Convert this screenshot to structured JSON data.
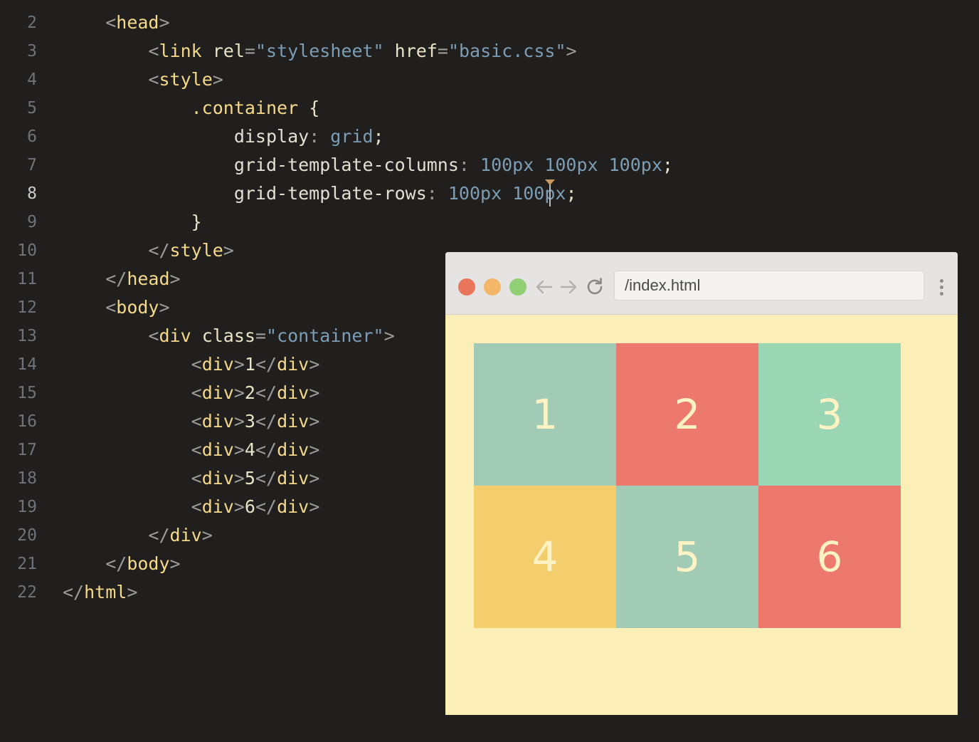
{
  "editor": {
    "lines": [
      {
        "number": "2",
        "tokens": [
          {
            "t": "ind",
            "v": "    "
          },
          {
            "t": "punc",
            "v": "<"
          },
          {
            "t": "tag",
            "v": "head"
          },
          {
            "t": "punc",
            "v": ">"
          }
        ]
      },
      {
        "number": "3",
        "tokens": [
          {
            "t": "ind",
            "v": "        "
          },
          {
            "t": "punc",
            "v": "<"
          },
          {
            "t": "tag",
            "v": "link"
          },
          {
            "t": "attr",
            "v": " rel"
          },
          {
            "t": "punc",
            "v": "="
          },
          {
            "t": "str",
            "v": "\"stylesheet\""
          },
          {
            "t": "attr",
            "v": " href"
          },
          {
            "t": "punc",
            "v": "="
          },
          {
            "t": "str",
            "v": "\"basic.css\""
          },
          {
            "t": "punc",
            "v": ">"
          }
        ]
      },
      {
        "number": "4",
        "tokens": [
          {
            "t": "ind",
            "v": "        "
          },
          {
            "t": "punc",
            "v": "<"
          },
          {
            "t": "tag",
            "v": "style"
          },
          {
            "t": "punc",
            "v": ">"
          }
        ]
      },
      {
        "number": "5",
        "tokens": [
          {
            "t": "ind",
            "v": "            "
          },
          {
            "t": "sel",
            "v": ".container"
          },
          {
            "t": "brace",
            "v": " {"
          }
        ]
      },
      {
        "number": "6",
        "tokens": [
          {
            "t": "ind",
            "v": "                "
          },
          {
            "t": "prop",
            "v": "display"
          },
          {
            "t": "punc",
            "v": ": "
          },
          {
            "t": "kw",
            "v": "grid"
          },
          {
            "t": "brace",
            "v": ";"
          }
        ]
      },
      {
        "number": "7",
        "tokens": [
          {
            "t": "ind",
            "v": "                "
          },
          {
            "t": "prop",
            "v": "grid-template-columns"
          },
          {
            "t": "punc",
            "v": ": "
          },
          {
            "t": "num",
            "v": "100px 100px 100px"
          },
          {
            "t": "brace",
            "v": ";"
          }
        ]
      },
      {
        "number": "8",
        "tokens": [
          {
            "t": "ind",
            "v": "                "
          },
          {
            "t": "prop",
            "v": "grid-template-rows"
          },
          {
            "t": "punc",
            "v": ": "
          },
          {
            "t": "num",
            "v": "100px 100px"
          },
          {
            "t": "brace",
            "v": ";"
          }
        ]
      },
      {
        "number": "9",
        "tokens": [
          {
            "t": "ind",
            "v": "            "
          },
          {
            "t": "brace",
            "v": "}"
          }
        ]
      },
      {
        "number": "10",
        "tokens": [
          {
            "t": "ind",
            "v": "        "
          },
          {
            "t": "punc",
            "v": "</"
          },
          {
            "t": "tag",
            "v": "style"
          },
          {
            "t": "punc",
            "v": ">"
          }
        ]
      },
      {
        "number": "11",
        "tokens": [
          {
            "t": "ind",
            "v": "    "
          },
          {
            "t": "punc",
            "v": "</"
          },
          {
            "t": "tag",
            "v": "head"
          },
          {
            "t": "punc",
            "v": ">"
          }
        ]
      },
      {
        "number": "12",
        "tokens": [
          {
            "t": "ind",
            "v": "    "
          },
          {
            "t": "punc",
            "v": "<"
          },
          {
            "t": "tag",
            "v": "body"
          },
          {
            "t": "punc",
            "v": ">"
          }
        ]
      },
      {
        "number": "13",
        "tokens": [
          {
            "t": "ind",
            "v": "        "
          },
          {
            "t": "punc",
            "v": "<"
          },
          {
            "t": "tag",
            "v": "div"
          },
          {
            "t": "attr",
            "v": " class"
          },
          {
            "t": "punc",
            "v": "="
          },
          {
            "t": "str",
            "v": "\"container\""
          },
          {
            "t": "punc",
            "v": ">"
          }
        ]
      },
      {
        "number": "14",
        "tokens": [
          {
            "t": "ind",
            "v": "            "
          },
          {
            "t": "punc",
            "v": "<"
          },
          {
            "t": "tag",
            "v": "div"
          },
          {
            "t": "punc",
            "v": ">"
          },
          {
            "t": "text",
            "v": "1"
          },
          {
            "t": "punc",
            "v": "</"
          },
          {
            "t": "tag",
            "v": "div"
          },
          {
            "t": "punc",
            "v": ">"
          }
        ]
      },
      {
        "number": "15",
        "tokens": [
          {
            "t": "ind",
            "v": "            "
          },
          {
            "t": "punc",
            "v": "<"
          },
          {
            "t": "tag",
            "v": "div"
          },
          {
            "t": "punc",
            "v": ">"
          },
          {
            "t": "text",
            "v": "2"
          },
          {
            "t": "punc",
            "v": "</"
          },
          {
            "t": "tag",
            "v": "div"
          },
          {
            "t": "punc",
            "v": ">"
          }
        ]
      },
      {
        "number": "16",
        "tokens": [
          {
            "t": "ind",
            "v": "            "
          },
          {
            "t": "punc",
            "v": "<"
          },
          {
            "t": "tag",
            "v": "div"
          },
          {
            "t": "punc",
            "v": ">"
          },
          {
            "t": "text",
            "v": "3"
          },
          {
            "t": "punc",
            "v": "</"
          },
          {
            "t": "tag",
            "v": "div"
          },
          {
            "t": "punc",
            "v": ">"
          }
        ]
      },
      {
        "number": "17",
        "tokens": [
          {
            "t": "ind",
            "v": "            "
          },
          {
            "t": "punc",
            "v": "<"
          },
          {
            "t": "tag",
            "v": "div"
          },
          {
            "t": "punc",
            "v": ">"
          },
          {
            "t": "text",
            "v": "4"
          },
          {
            "t": "punc",
            "v": "</"
          },
          {
            "t": "tag",
            "v": "div"
          },
          {
            "t": "punc",
            "v": ">"
          }
        ]
      },
      {
        "number": "18",
        "tokens": [
          {
            "t": "ind",
            "v": "            "
          },
          {
            "t": "punc",
            "v": "<"
          },
          {
            "t": "tag",
            "v": "div"
          },
          {
            "t": "punc",
            "v": ">"
          },
          {
            "t": "text",
            "v": "5"
          },
          {
            "t": "punc",
            "v": "</"
          },
          {
            "t": "tag",
            "v": "div"
          },
          {
            "t": "punc",
            "v": ">"
          }
        ]
      },
      {
        "number": "19",
        "tokens": [
          {
            "t": "ind",
            "v": "            "
          },
          {
            "t": "punc",
            "v": "<"
          },
          {
            "t": "tag",
            "v": "div"
          },
          {
            "t": "punc",
            "v": ">"
          },
          {
            "t": "text",
            "v": "6"
          },
          {
            "t": "punc",
            "v": "</"
          },
          {
            "t": "tag",
            "v": "div"
          },
          {
            "t": "punc",
            "v": ">"
          }
        ]
      },
      {
        "number": "20",
        "tokens": [
          {
            "t": "ind",
            "v": "        "
          },
          {
            "t": "punc",
            "v": "</"
          },
          {
            "t": "tag",
            "v": "div"
          },
          {
            "t": "punc",
            "v": ">"
          }
        ]
      },
      {
        "number": "21",
        "tokens": [
          {
            "t": "ind",
            "v": "    "
          },
          {
            "t": "punc",
            "v": "</"
          },
          {
            "t": "tag",
            "v": "body"
          },
          {
            "t": "punc",
            "v": ">"
          }
        ]
      },
      {
        "number": "22",
        "tokens": [
          {
            "t": "punc",
            "v": "</"
          },
          {
            "t": "tag",
            "v": "html"
          },
          {
            "t": "punc",
            "v": ">"
          }
        ]
      }
    ],
    "active_line": "8",
    "colors": {
      "background": "#201f1e",
      "tag": "#f5d98a",
      "string": "#7c9db3",
      "punctuation": "#9c9d98"
    }
  },
  "browser": {
    "url": "/index.html",
    "traffic_lights": [
      "close-icon",
      "minimize-icon",
      "maximize-icon"
    ],
    "nav_icons": [
      "back-arrow-icon",
      "forward-arrow-icon",
      "reload-icon"
    ],
    "menu_icon": "kebab-menu-icon",
    "page_background": "#fbeeb6",
    "grid_cells": [
      {
        "label": "1",
        "color": "#a2cbb5"
      },
      {
        "label": "2",
        "color": "#ed786e"
      },
      {
        "label": "3",
        "color": "#9bd6b4"
      },
      {
        "label": "4",
        "color": "#f4cd6d"
      },
      {
        "label": "5",
        "color": "#a2cbb5"
      },
      {
        "label": "6",
        "color": "#ed786e"
      }
    ]
  }
}
